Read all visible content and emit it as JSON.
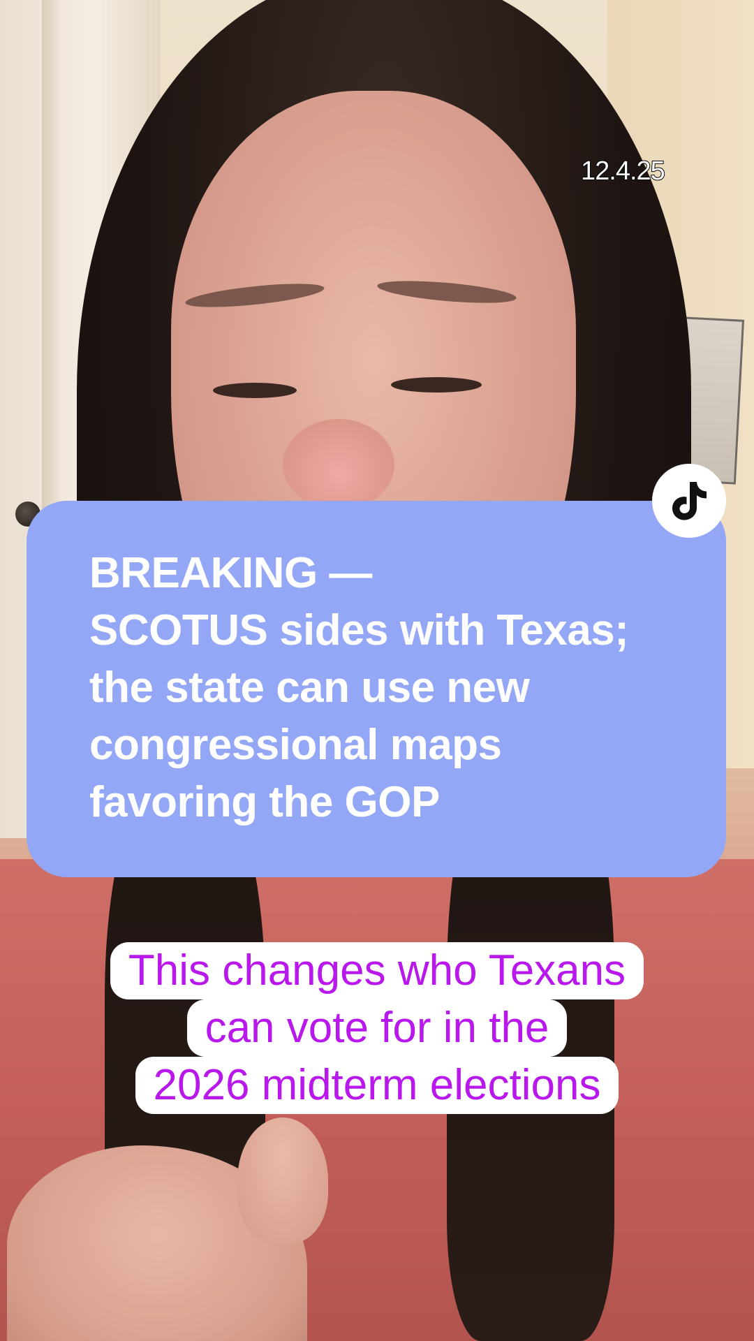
{
  "video": {
    "date_stamp": "12.4.25",
    "badge_icon": "tiktok-logo-icon"
  },
  "headline": {
    "lines": [
      "BREAKING —",
      "SCOTUS sides with Texas;",
      "the state can use new",
      "congressional maps",
      "favoring the GOP"
    ],
    "background_color": "#93a7f6",
    "text_color": "#ffffff"
  },
  "caption": {
    "lines": [
      "This changes who Texans",
      "can vote for in the",
      "2026 midterm elections"
    ],
    "background_color": "#ffffff",
    "text_color": "#b818ec"
  }
}
